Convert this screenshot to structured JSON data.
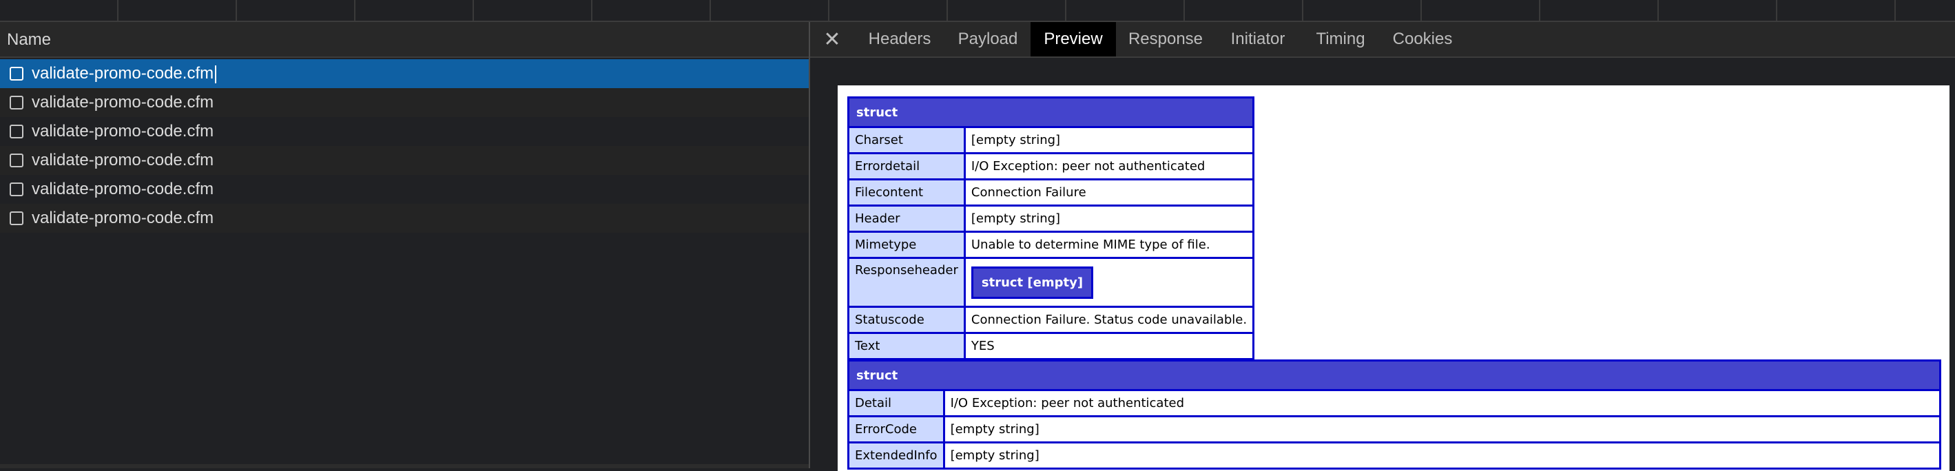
{
  "request_list": {
    "column_header": "Name",
    "requests": [
      {
        "name": "validate-promo-code.cfm",
        "selected": true
      },
      {
        "name": "validate-promo-code.cfm",
        "selected": false
      },
      {
        "name": "validate-promo-code.cfm",
        "selected": false
      },
      {
        "name": "validate-promo-code.cfm",
        "selected": false
      },
      {
        "name": "validate-promo-code.cfm",
        "selected": false
      },
      {
        "name": "validate-promo-code.cfm",
        "selected": false
      }
    ]
  },
  "details": {
    "close_icon": "close-icon",
    "tabs": [
      {
        "label": "Headers"
      },
      {
        "label": "Payload"
      },
      {
        "label": "Preview",
        "active": true
      },
      {
        "label": "Response"
      },
      {
        "label": "Initiator"
      },
      {
        "label": "Timing"
      },
      {
        "label": "Cookies"
      }
    ]
  },
  "preview": {
    "dump1": {
      "title": "struct",
      "rows": [
        {
          "key": "Charset",
          "value": "[empty string]"
        },
        {
          "key": "Errordetail",
          "value": "I/O Exception: peer not authenticated"
        },
        {
          "key": "Filecontent",
          "value": "Connection Failure"
        },
        {
          "key": "Header",
          "value": "[empty string]"
        },
        {
          "key": "Mimetype",
          "value": "Unable to determine MIME type of file."
        },
        {
          "key": "Responseheader",
          "nested": "struct [empty]"
        },
        {
          "key": "Statuscode",
          "value": "Connection Failure. Status code unavailable."
        },
        {
          "key": "Text",
          "value": "YES"
        }
      ]
    },
    "dump2": {
      "title": "struct",
      "rows": [
        {
          "key": "Detail",
          "value": "I/O Exception: peer not authenticated"
        },
        {
          "key": "ErrorCode",
          "value": "[empty string]"
        },
        {
          "key": "ExtendedInfo",
          "value": "[empty string]"
        }
      ]
    }
  },
  "colors": {
    "selected_row": "#0f60a3",
    "dump_header": "#4444cc",
    "dump_border": "#0000cc",
    "dump_key_bg": "#ccd9ff"
  }
}
